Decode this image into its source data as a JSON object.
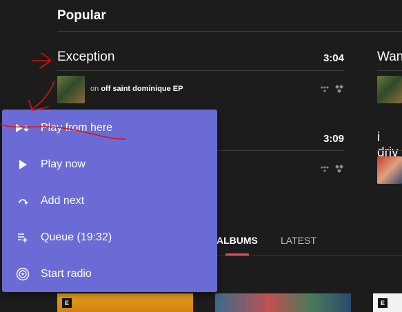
{
  "popular": {
    "title": "Popular",
    "tracks": [
      {
        "title": "Exception",
        "duration": "3:04",
        "on_prefix": "on",
        "album": "off saint dominique EP"
      },
      {
        "title": "",
        "duration": "3:09",
        "on_prefix": "",
        "album": ""
      }
    ],
    "side_tracks": [
      {
        "title": "Wan"
      },
      {
        "title": "i driv"
      }
    ]
  },
  "tabs": [
    {
      "label": "ALBUMS",
      "active": true
    },
    {
      "label": "LATEST",
      "active": false
    }
  ],
  "albums": [
    {
      "explicit_label": "E",
      "color": "#e8a020"
    },
    {
      "explicit_label": "",
      "color": "#3a6b8a"
    },
    {
      "explicit_label": "E",
      "color": "#ffffff"
    }
  ],
  "menu": {
    "items": [
      {
        "label": "Play from here",
        "icon": "play-from-here-icon"
      },
      {
        "label": "Play now",
        "icon": "play-icon"
      },
      {
        "label": "Add next",
        "icon": "add-next-icon"
      },
      {
        "label": "Queue (19:32)",
        "icon": "queue-add-icon"
      },
      {
        "label": "Start radio",
        "icon": "radio-icon"
      }
    ]
  },
  "colors": {
    "background": "#1d1c1d",
    "menu_background": "#6b6bd6",
    "tab_underline": "#d9534f",
    "annotation": "#e01010"
  }
}
